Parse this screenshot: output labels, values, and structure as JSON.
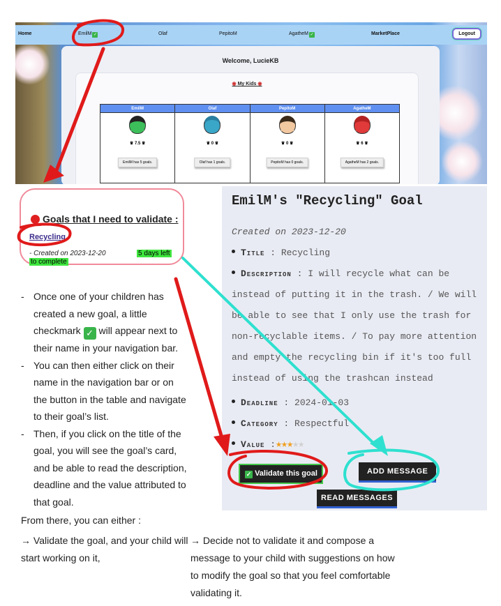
{
  "navbar": {
    "home": "Home",
    "kids": [
      "EmilM",
      "Olaf",
      "PepitoM",
      "AgatheM"
    ],
    "marketplace": "MarketPlace",
    "logout": "Logout"
  },
  "welcome": "Welcome, LucieKB",
  "my_kids": "My Kids",
  "kids_table": [
    {
      "name": "EmilM",
      "score": "7.5",
      "button": "EmilM has 5 goals."
    },
    {
      "name": "Olaf",
      "score": "0",
      "button": "Olaf has 1 goals."
    },
    {
      "name": "PepitoM",
      "score": "0",
      "button": "PepitoM has 0 goals."
    },
    {
      "name": "AgatheM",
      "score": "6",
      "button": "AgatheM has 2 goals."
    }
  ],
  "goals_box": {
    "title": "Goals that I need to validate :",
    "goal_link": "Recycling",
    "created": "-  Created on 2023-12-20",
    "days_left": "5 days left",
    "to_complete": "to complete"
  },
  "instructions": {
    "b1_a": "Once one of your children has created a new goal, a little checkmark",
    "b1_b": "will appear next to their name in your navigation bar.",
    "b2": "You can then either click on their name in the navigation bar or on the button in the table and navigate to their goal’s list.",
    "b3": "Then, if you click on the title of the goal, you will see the goal’s card, and be able to read the description, deadline and the value attributed to that goal.",
    "from_there": "From there, you can either :",
    "option_a": "→ Validate the goal, and your child will start working on it,",
    "option_b": "→ Decide not to validate it and compose a message to your child with suggestions on how to modify the goal so that you feel comfortable validating it."
  },
  "goal_card": {
    "title": "EmilM's \"Recycling\" Goal",
    "created": "Created on 2023-12-20",
    "title_label": "Title",
    "title_value": "Recycling",
    "description_label": "Description",
    "description_value": "I will recycle what can be instead of putting it in the trash. / We will be able to see that I only use the trash for non-recyclable items. / To pay more attention and empty the recycling bin if it's too full instead of using the trashcan instead",
    "deadline_label": "Deadline",
    "deadline_value": "2024-01-03",
    "category_label": "Category",
    "category_value": "Respectful",
    "value_label": "Value",
    "value_stars": 3,
    "value_max": 5,
    "validate_button": "Validate this goal",
    "add_message_button": "ADD MESSAGE",
    "read_messages_button": "READ MESSAGES"
  },
  "colors": {
    "annotation_red": "#e01a1a",
    "annotation_cyan": "#2ee0cf",
    "check_green": "#39b44a",
    "highlight_green": "#3ee53e"
  }
}
